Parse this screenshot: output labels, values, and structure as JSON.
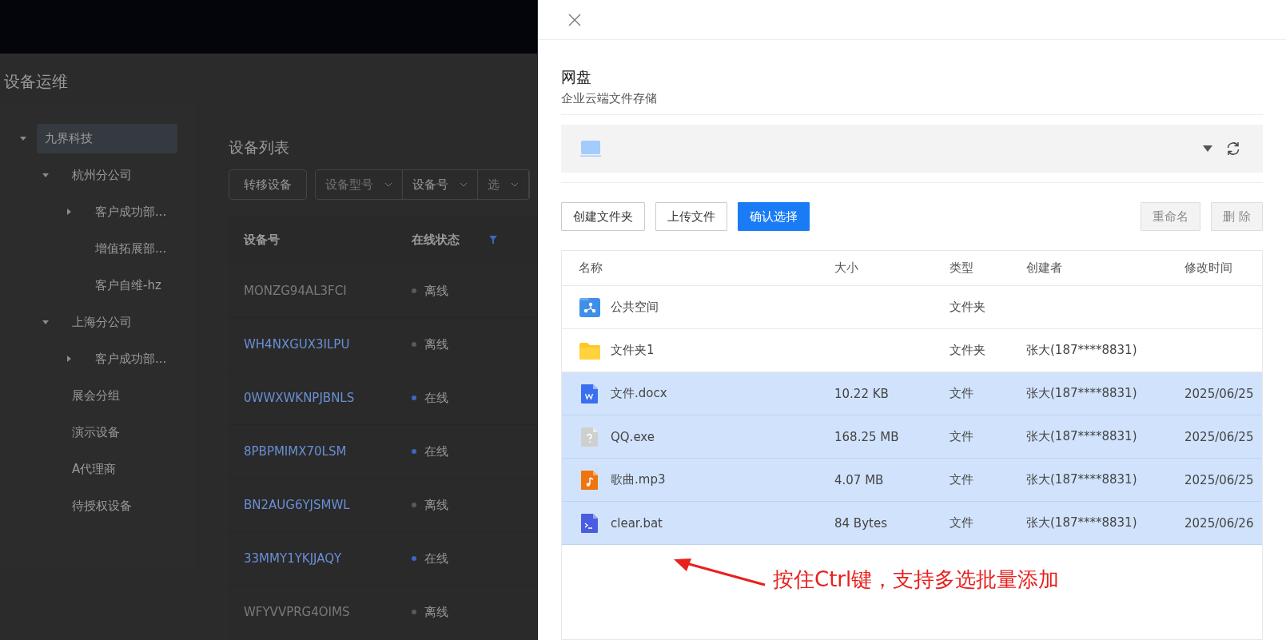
{
  "background_page": {
    "title": "设备运维",
    "tree": [
      {
        "label": "九界科技",
        "expanded": true,
        "selected": true,
        "children": [
          {
            "label": "杭州分公司",
            "expanded": true,
            "selected": false,
            "children": [
              {
                "label": "客户成功部...",
                "expanded": false,
                "selected": false
              },
              {
                "label": "增值拓展部...",
                "selected": false
              },
              {
                "label": "客户自维-hz",
                "selected": false
              }
            ]
          },
          {
            "label": "上海分公司",
            "expanded": true,
            "selected": false,
            "children": [
              {
                "label": "客户成功部...",
                "expanded": false,
                "selected": false
              }
            ]
          },
          {
            "label": "展会分组",
            "selected": false
          },
          {
            "label": "演示设备",
            "selected": false
          },
          {
            "label": "A代理商",
            "selected": false
          },
          {
            "label": "待授权设备",
            "selected": false
          }
        ]
      }
    ],
    "list_title": "设备列表",
    "transfer_button": "转移设备",
    "filters": [
      {
        "placeholder": "设备型号"
      },
      {
        "value": "设备号"
      },
      {
        "placeholder": "选"
      }
    ],
    "columns": [
      {
        "label": "设备号"
      },
      {
        "label": "在线状态",
        "filter": true
      }
    ],
    "rows": [
      {
        "device": "MONZG94AL3FCI",
        "disabled": true,
        "status": "离线",
        "color": "#5a5a5a"
      },
      {
        "device": "WH4NXGUX3ILPU",
        "disabled": false,
        "status": "离线",
        "color": "#5a5a5a"
      },
      {
        "device": "0WWXWKNPJBNLS",
        "disabled": false,
        "status": "在线",
        "color": "#3b68c0"
      },
      {
        "device": "8PBPMIMX70LSM",
        "disabled": false,
        "status": "在线",
        "color": "#3b68c0"
      },
      {
        "device": "BN2AUG6YJSMWL",
        "disabled": false,
        "status": "离线",
        "color": "#5a5a5a"
      },
      {
        "device": "33MMY1YKJJAQY",
        "disabled": false,
        "status": "在线",
        "color": "#3b68c0"
      },
      {
        "device": "WFYVVPRG4OIMS",
        "disabled": true,
        "status": "离线",
        "color": "#5a5a5a"
      }
    ]
  },
  "drawer": {
    "title": "网盘",
    "subtitle": "企业云端文件存储",
    "buttons": [
      {
        "label": "创建文件夹",
        "kind": "default",
        "disabled": false
      },
      {
        "label": "上传文件",
        "kind": "default",
        "disabled": false
      },
      {
        "label": "确认选择",
        "kind": "primary",
        "disabled": false
      }
    ],
    "right_buttons": [
      {
        "label": "重命名",
        "disabled": true
      },
      {
        "label": "删 除",
        "disabled": true
      }
    ],
    "columns": [
      "名称",
      "大小",
      "类型",
      "创建者",
      "修改时间"
    ],
    "rows": [
      {
        "kind": "shared-folder",
        "name": "公共空间",
        "type": "文件夹",
        "selected": false
      },
      {
        "kind": "folder",
        "name": "文件夹1",
        "type": "文件夹",
        "creator": "张大(187****8831)",
        "selected": false
      },
      {
        "kind": "word",
        "name": "文件.docx",
        "size": "10.22 KB",
        "type": "文件",
        "creator": "张大(187****8831)",
        "modified": "2025/06/25",
        "selected": true
      },
      {
        "kind": "unknown",
        "name": "QQ.exe",
        "size": "168.25 MB",
        "type": "文件",
        "creator": "张大(187****8831)",
        "modified": "2025/06/25",
        "selected": true
      },
      {
        "kind": "audio",
        "name": "歌曲.mp3",
        "size": "4.07 MB",
        "type": "文件",
        "creator": "张大(187****8831)",
        "modified": "2025/06/25",
        "selected": true
      },
      {
        "kind": "script",
        "name": "clear.bat",
        "size": "84 Bytes",
        "type": "文件",
        "creator": "张大(187****8831)",
        "modified": "2025/06/26",
        "selected": true
      }
    ]
  },
  "annotation": {
    "text": "按住Ctrl键，支持多选批量添加"
  }
}
